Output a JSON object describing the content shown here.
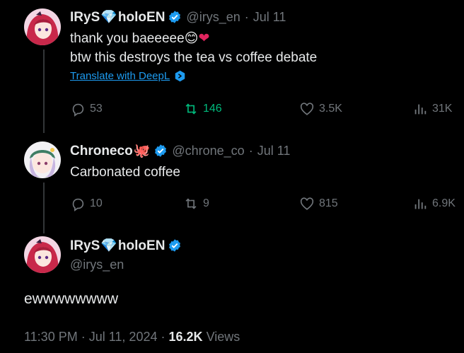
{
  "tweets": [
    {
      "author": {
        "name": "IRyS",
        "name_suffix": "holoEN",
        "handle": "@irys_en",
        "date": "Jul 11"
      },
      "text_line1": "thank you baeeeee",
      "text_line2": "btw this destroys the tea vs coffee debate",
      "translate_label": "Translate with DeepL",
      "replies": "53",
      "retweets": "146",
      "likes": "3.5K",
      "views": "31K"
    },
    {
      "author": {
        "name": "Chroneco",
        "handle": "@chrone_co",
        "date": "Jul 11"
      },
      "text": "Carbonated coffee",
      "replies": "10",
      "retweets": "9",
      "likes": "815",
      "views": "6.9K"
    }
  ],
  "main_tweet": {
    "author": {
      "name": "IRyS",
      "name_suffix": "holoEN",
      "handle": "@irys_en"
    },
    "text": "ewwwwwwww",
    "time": "11:30 PM",
    "date": "Jul 11, 2024",
    "views_count": "16.2K",
    "views_label": "Views"
  },
  "colors": {
    "background": "#000000",
    "text": "#e7e9ea",
    "muted": "#71767b",
    "accent": "#1d9bf0",
    "retweet_active": "#00ba7c"
  },
  "icons": [
    "reply-icon",
    "retweet-icon",
    "like-icon",
    "views-icon",
    "verified-icon",
    "deepl-icon"
  ]
}
